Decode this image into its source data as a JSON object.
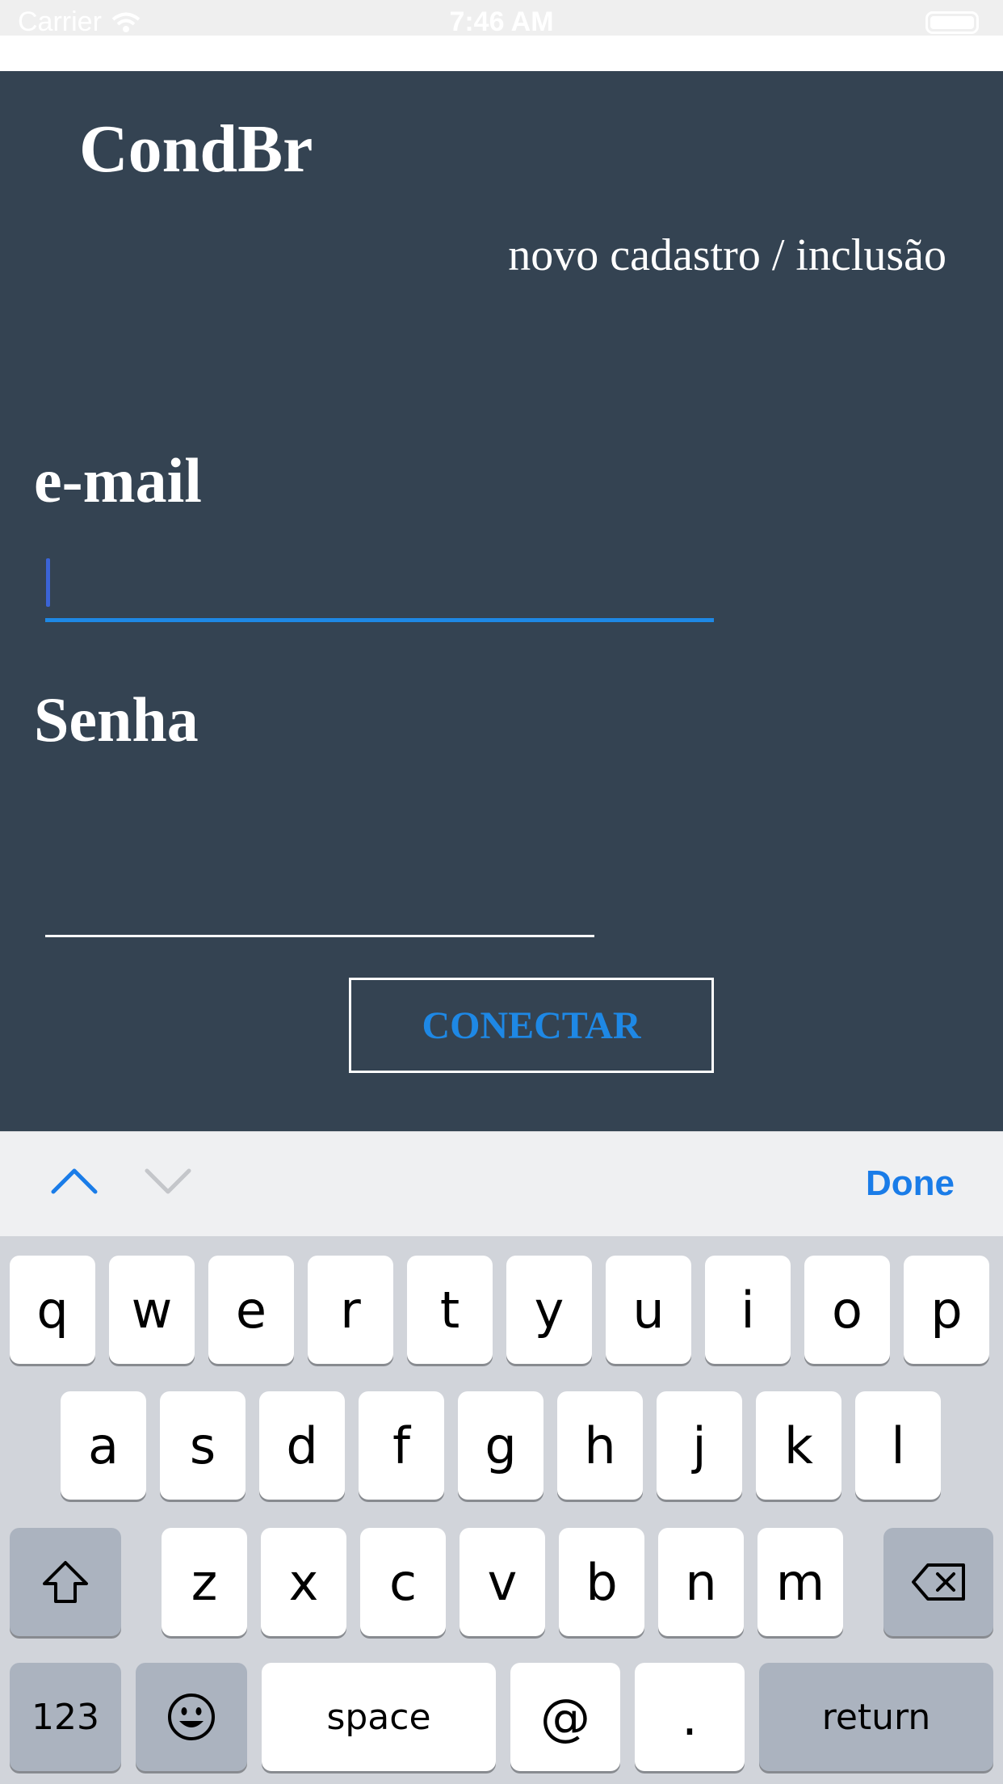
{
  "status_bar": {
    "carrier": "Carrier",
    "time": "7:46 AM"
  },
  "header": {
    "title": "CondBr",
    "signup_link": "novo cadastro / inclusão"
  },
  "form": {
    "email_label": "e-mail",
    "email_value": "",
    "password_label": "Senha",
    "password_value": "",
    "connect_button": "CONECTAR"
  },
  "accessory_bar": {
    "done_label": "Done"
  },
  "keyboard": {
    "row1": [
      "q",
      "w",
      "e",
      "r",
      "t",
      "y",
      "u",
      "i",
      "o",
      "p"
    ],
    "row2": [
      "a",
      "s",
      "d",
      "f",
      "g",
      "h",
      "j",
      "k",
      "l"
    ],
    "row3": [
      "z",
      "x",
      "c",
      "v",
      "b",
      "n",
      "m"
    ],
    "numbers_key": "123",
    "space_key": "space",
    "at_key": "@",
    "period_key": ".",
    "return_key": "return"
  },
  "colors": {
    "panel_background": "#344352",
    "accent_blue": "#1e88e5",
    "keyboard_background": "#d1d4da"
  }
}
